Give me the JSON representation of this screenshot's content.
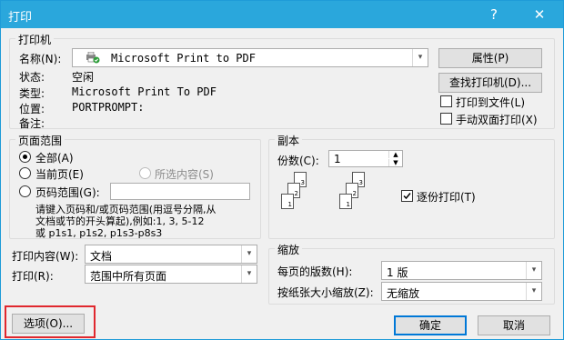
{
  "window": {
    "title": "打印",
    "help_glyph": "?",
    "close_glyph": "✕"
  },
  "printer": {
    "group_label": "打印机",
    "name_label": "名称(N):",
    "name_value": "Microsoft Print to PDF",
    "status_label": "状态:",
    "status_value": "空闲",
    "type_label": "类型:",
    "type_value": "Microsoft Print To PDF",
    "location_label": "位置:",
    "location_value": "PORTPROMPT:",
    "comment_label": "备注:",
    "comment_value": "",
    "properties_button": "属性(P)",
    "find_printer_button": "查找打印机(D)...",
    "print_to_file_label": "打印到文件(L)",
    "print_to_file_checked": false,
    "manual_duplex_label": "手动双面打印(X)",
    "manual_duplex_checked": false
  },
  "page_range": {
    "group_label": "页面范围",
    "all_label": "全部(A)",
    "current_label": "当前页(E)",
    "selection_label": "所选内容(S)",
    "pages_label": "页码范围(G):",
    "pages_value": "",
    "selected": "all",
    "hint_line1": "请键入页码和/或页码范围(用逗号分隔,从",
    "hint_line2": "文档或节的开头算起),例如:1, 3, 5-12",
    "hint_line3": "或 p1s1, p1s2, p1s3-p8s3"
  },
  "print_what": {
    "label": "打印内容(W):",
    "value": "文档"
  },
  "print": {
    "label": "打印(R):",
    "value": "范围中所有页面"
  },
  "copies": {
    "group_label": "副本",
    "count_label": "份数(C):",
    "count_value": "1",
    "collate_label": "逐份打印(T)",
    "collate_checked": true
  },
  "zoom": {
    "group_label": "缩放",
    "pages_per_sheet_label": "每页的版数(H):",
    "pages_per_sheet_value": "1 版",
    "scale_label": "按纸张大小缩放(Z):",
    "scale_value": "无缩放"
  },
  "footer": {
    "options_button": "选项(O)...",
    "ok_button": "确定",
    "cancel_button": "取消"
  },
  "colors": {
    "title_bar": "#2aa7dc",
    "highlight_box": "#e0282e",
    "default_button_border": "#0078d7"
  }
}
